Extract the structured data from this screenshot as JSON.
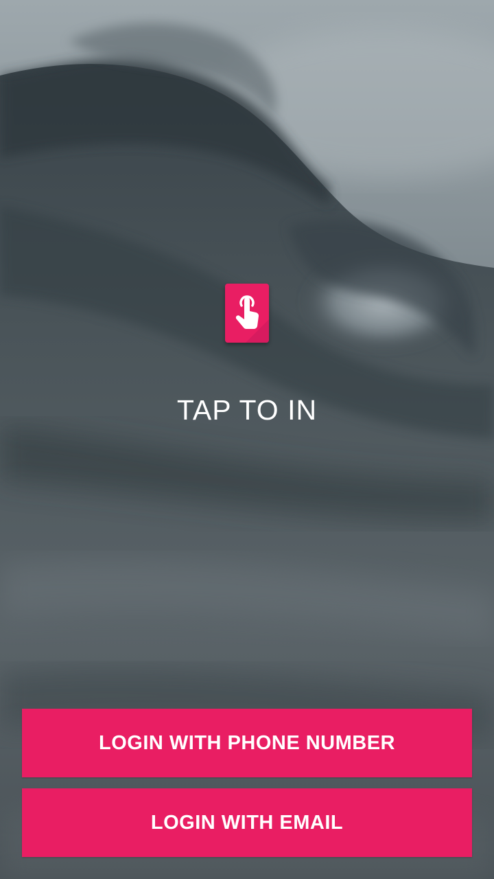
{
  "colors": {
    "accent": "#E91E63",
    "text": "#FFFFFF"
  },
  "background": {
    "icon": "ocean-wave-photo"
  },
  "app_icon": {
    "icon": "tap-hand-icon"
  },
  "tap_label": "TAP TO IN",
  "buttons": {
    "phone_login": "LOGIN WITH PHONE NUMBER",
    "email_login": "LOGIN WITH EMAIL"
  }
}
